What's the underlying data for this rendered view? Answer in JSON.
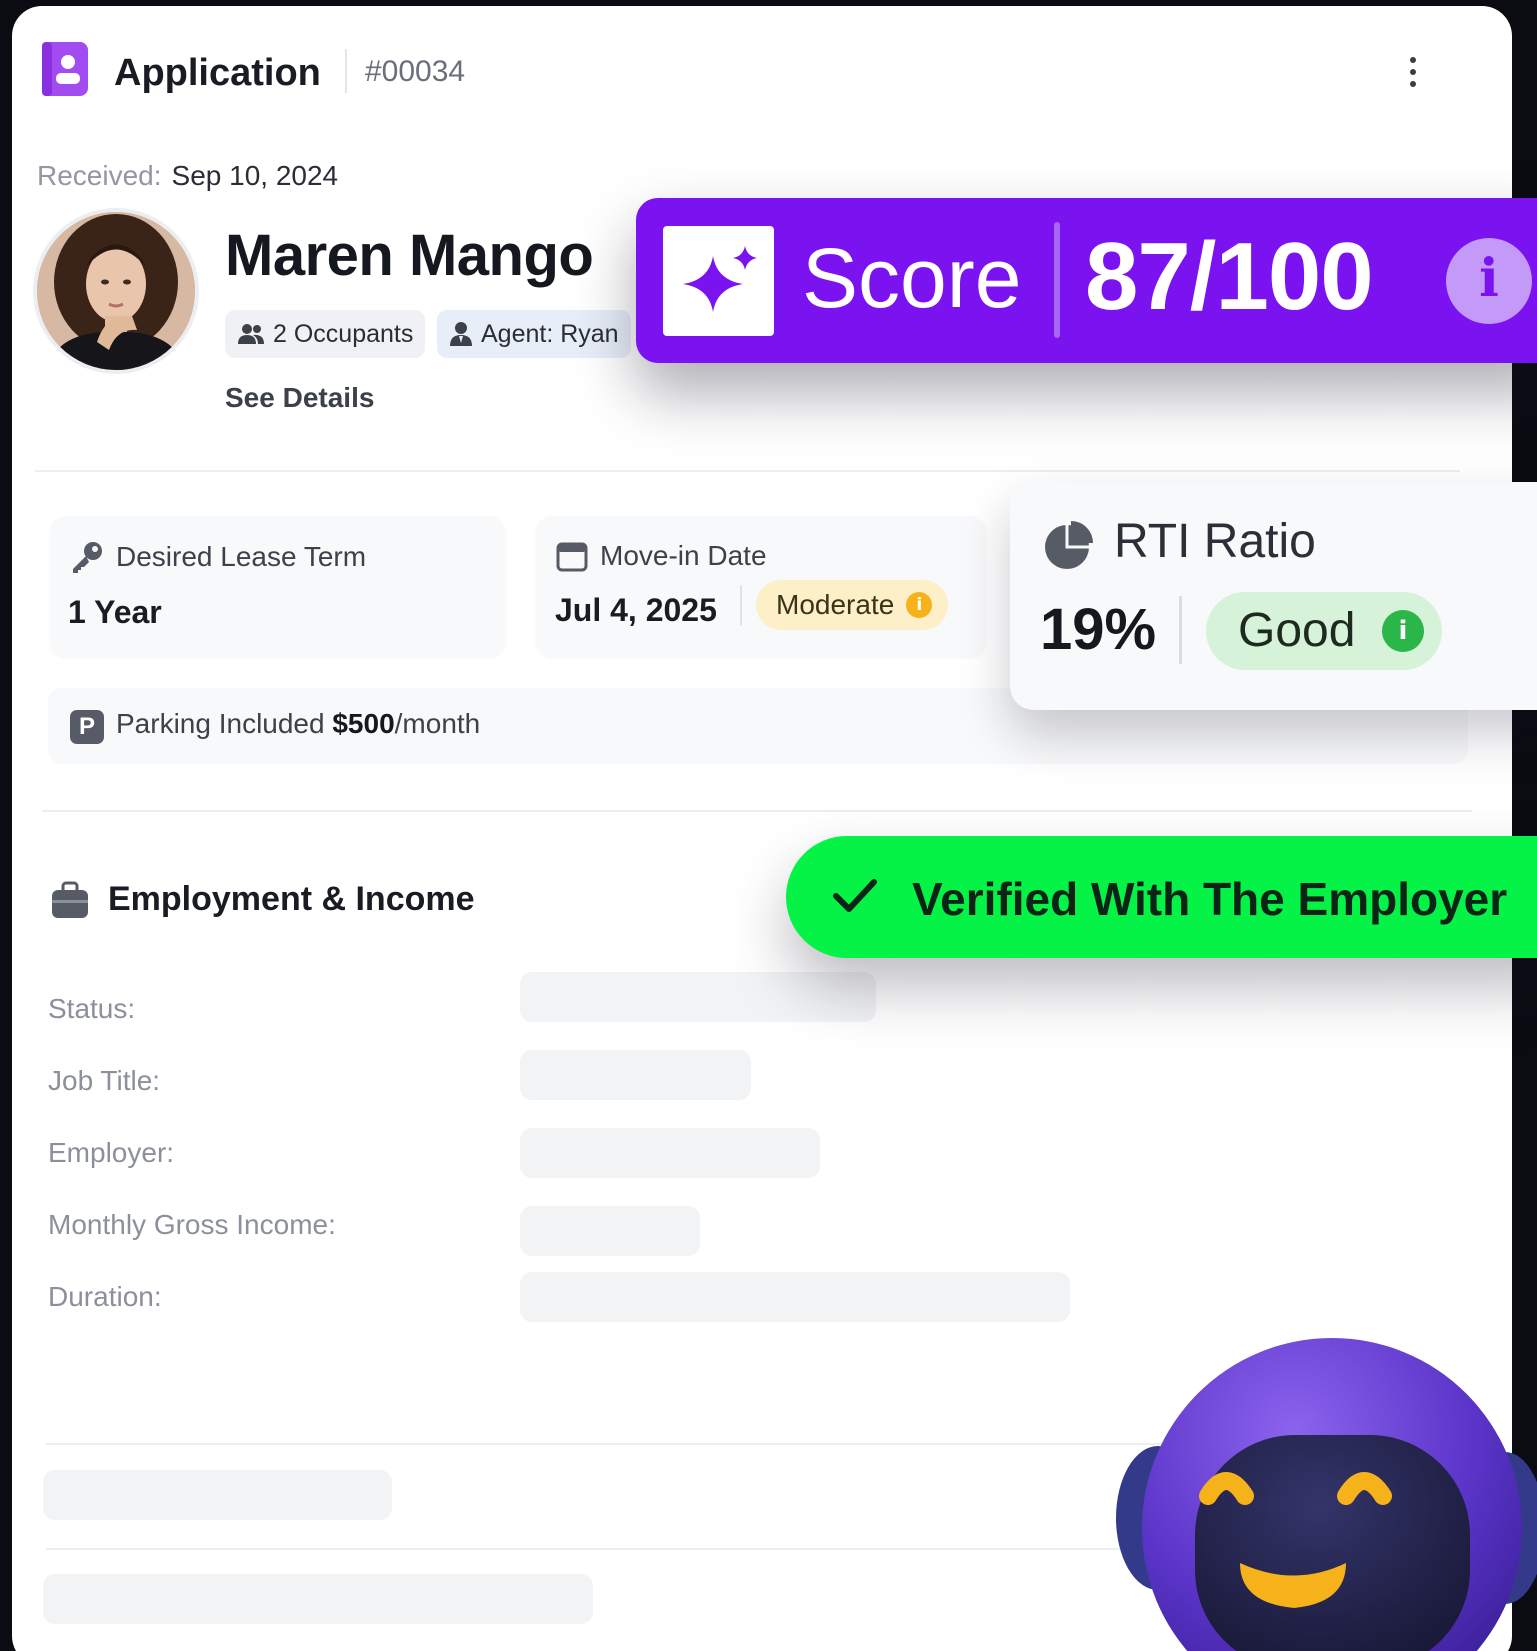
{
  "header": {
    "title": "Application",
    "application_id": "#00034"
  },
  "received": {
    "label": "Received:",
    "date": "Sep 10, 2024"
  },
  "applicant": {
    "name": "Maren Mango",
    "occupants": "2 Occupants",
    "agent": "Agent: Ryan",
    "see_details": "See Details"
  },
  "score": {
    "label": "Score",
    "value": "87/100",
    "info_glyph": "i"
  },
  "lease": {
    "label": "Desired Lease Term",
    "value": "1 Year"
  },
  "move_in": {
    "label": "Move-in Date",
    "value": "Jul 4, 2025",
    "badge": "Moderate",
    "badge_color": "#fdefc7"
  },
  "rti": {
    "title": "RTI Ratio",
    "value": "19%",
    "rating": "Good",
    "rating_color": "#d6f2d8"
  },
  "parking": {
    "prefix": "Parking Included",
    "amount": "$500",
    "suffix": "/month",
    "icon_glyph": "P"
  },
  "employment": {
    "title": "Employment & Income",
    "verified_label": "Verified With The Employer",
    "fields": [
      "Status:",
      "Job Title:",
      "Employer:",
      "Monthly Gross Income:",
      "Duration:"
    ]
  },
  "colors": {
    "accent_purple": "#7b12f0",
    "verified_green": "#05f247",
    "moderate_yellow": "#f6b21a",
    "good_green": "#2bb64a"
  },
  "icons": [
    "app-badge-icon",
    "kebab-menu-icon",
    "people-icon",
    "agent-icon",
    "sparkle-icon",
    "info-icon",
    "key-icon",
    "calendar-icon",
    "pie-chart-icon",
    "parking-icon",
    "briefcase-icon",
    "checkmark-icon",
    "robot-mascot-icon"
  ]
}
